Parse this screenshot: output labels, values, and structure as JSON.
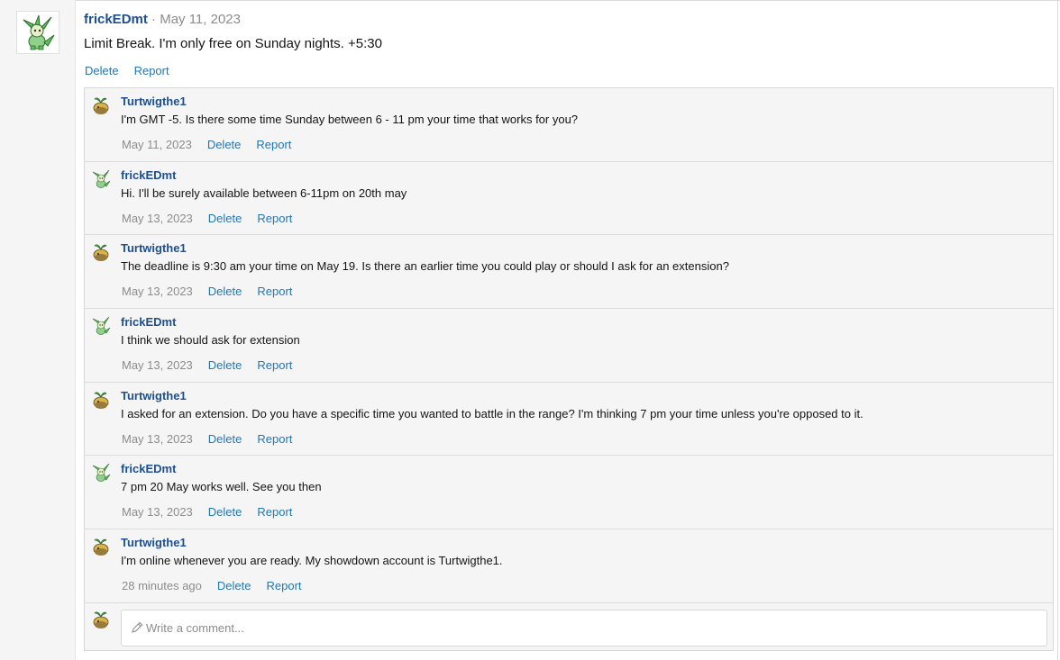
{
  "post": {
    "username": "frickEDmt",
    "separator": "·",
    "date": "May 11, 2023",
    "text": "Limit Break. I'm only free on Sunday nights. +5:30",
    "actions": {
      "delete": "Delete",
      "report": "Report"
    }
  },
  "comments": [
    {
      "username": "Turtwigthe1",
      "text": "I'm GMT -5. Is there some time Sunday between 6 - 11 pm your time that works for you?",
      "date": "May 11, 2023",
      "delete": "Delete",
      "report": "Report",
      "avatar": "turtwig-avatar-icon"
    },
    {
      "username": "frickEDmt",
      "text": "Hi. I'll be surely available between 6-11pm on 20th may",
      "date": "May 13, 2023",
      "delete": "Delete",
      "report": "Report",
      "avatar": "leafeon-avatar-icon"
    },
    {
      "username": "Turtwigthe1",
      "text": "The deadline is 9:30 am your time on May 19. Is there an earlier time you could play or should I ask for an extension?",
      "date": "May 13, 2023",
      "delete": "Delete",
      "report": "Report",
      "avatar": "turtwig-avatar-icon"
    },
    {
      "username": "frickEDmt",
      "text": "I think we should ask for extension",
      "date": "May 13, 2023",
      "delete": "Delete",
      "report": "Report",
      "avatar": "leafeon-avatar-icon"
    },
    {
      "username": "Turtwigthe1",
      "text": "I asked for an extension. Do you have a specific time you wanted to battle in the range? I'm thinking 7 pm your time unless you're opposed to it.",
      "date": "May 13, 2023",
      "delete": "Delete",
      "report": "Report",
      "avatar": "turtwig-avatar-icon"
    },
    {
      "username": "frickEDmt",
      "text": "7 pm 20 May works well. See you then",
      "date": "May 13, 2023",
      "delete": "Delete",
      "report": "Report",
      "avatar": "leafeon-avatar-icon"
    },
    {
      "username": "Turtwigthe1",
      "text": "I'm online whenever you are ready. My showdown account is Turtwigthe1.",
      "date": "28 minutes ago",
      "delete": "Delete",
      "report": "Report",
      "avatar": "turtwig-avatar-icon"
    }
  ],
  "reply": {
    "placeholder": "Write a comment...",
    "icon": "pencil-icon"
  },
  "colors": {
    "link": "#2577b1",
    "username": "#1d4f91",
    "muted": "#8c8c8c",
    "panel": "#f5f5f5"
  }
}
